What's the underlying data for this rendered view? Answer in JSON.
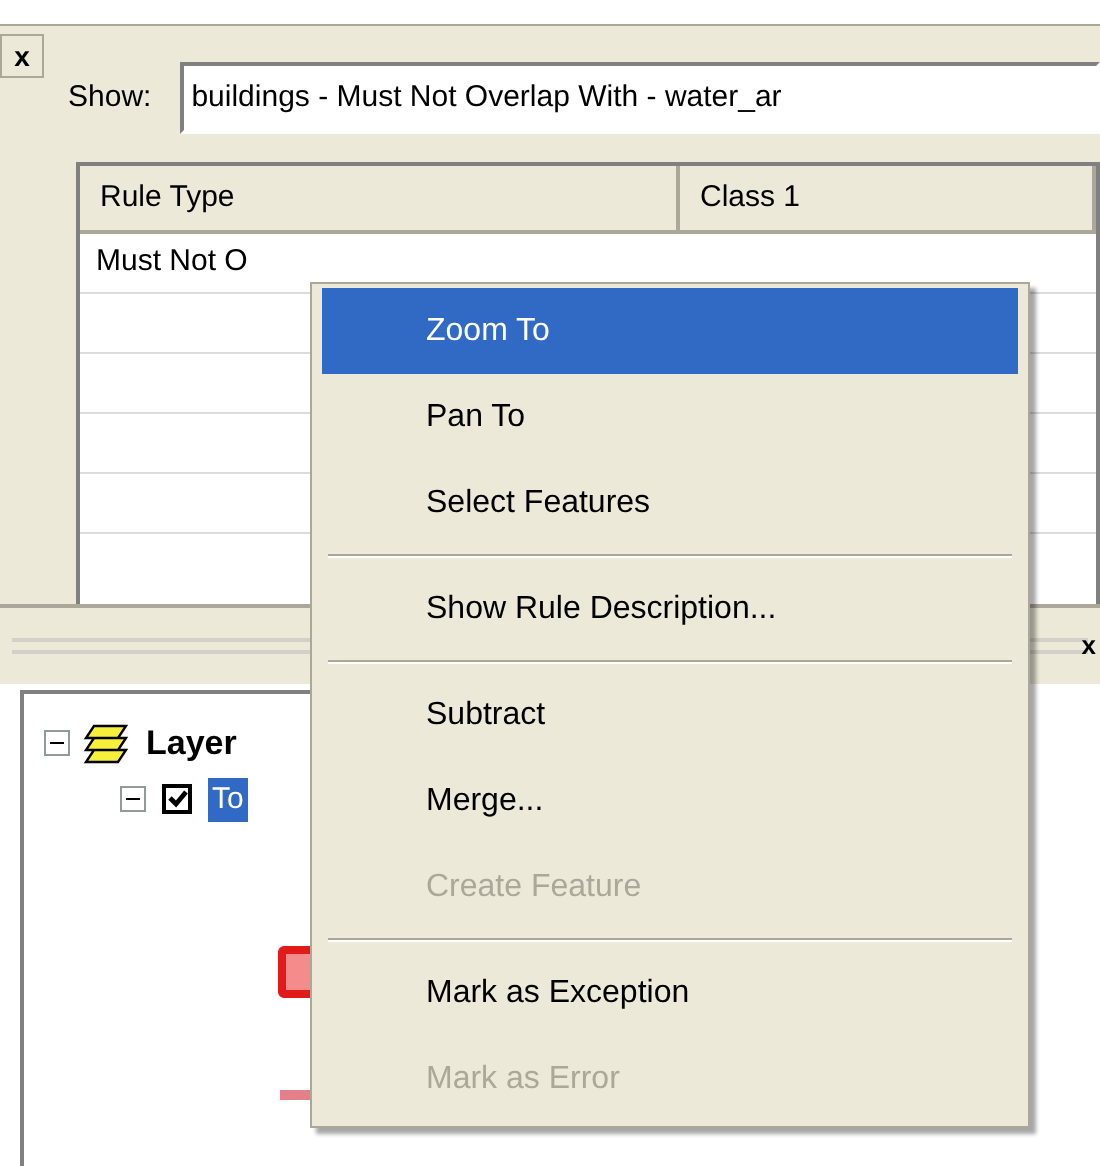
{
  "close_button": {
    "label": "x"
  },
  "show": {
    "label": "Show:",
    "value": "buildings - Must Not Overlap With - water_ar"
  },
  "table": {
    "columns": [
      "Rule Type",
      "Class 1"
    ],
    "rows": [
      {
        "cells": [
          "Must Not O"
        ]
      }
    ]
  },
  "lower_panel": {
    "close_button": {
      "label": "x"
    },
    "tree": [
      {
        "label": "Layer",
        "expanded": true,
        "children": [
          {
            "label": "To",
            "checked": true,
            "selected": true,
            "expanded": true
          }
        ]
      }
    ]
  },
  "context_menu": [
    {
      "label": "Zoom To",
      "selected": true,
      "disabled": false,
      "separator_after": false
    },
    {
      "label": "Pan To",
      "selected": false,
      "disabled": false,
      "separator_after": false
    },
    {
      "label": "Select Features",
      "selected": false,
      "disabled": false,
      "separator_after": true
    },
    {
      "label": "Show Rule Description...",
      "selected": false,
      "disabled": false,
      "separator_after": true
    },
    {
      "label": "Subtract",
      "selected": false,
      "disabled": false,
      "separator_after": false
    },
    {
      "label": "Merge...",
      "selected": false,
      "disabled": false,
      "separator_after": false
    },
    {
      "label": "Create Feature",
      "selected": false,
      "disabled": true,
      "separator_after": true
    },
    {
      "label": "Mark as Exception",
      "selected": false,
      "disabled": false,
      "separator_after": false
    },
    {
      "label": "Mark as Error",
      "selected": false,
      "disabled": true,
      "separator_after": false
    }
  ]
}
